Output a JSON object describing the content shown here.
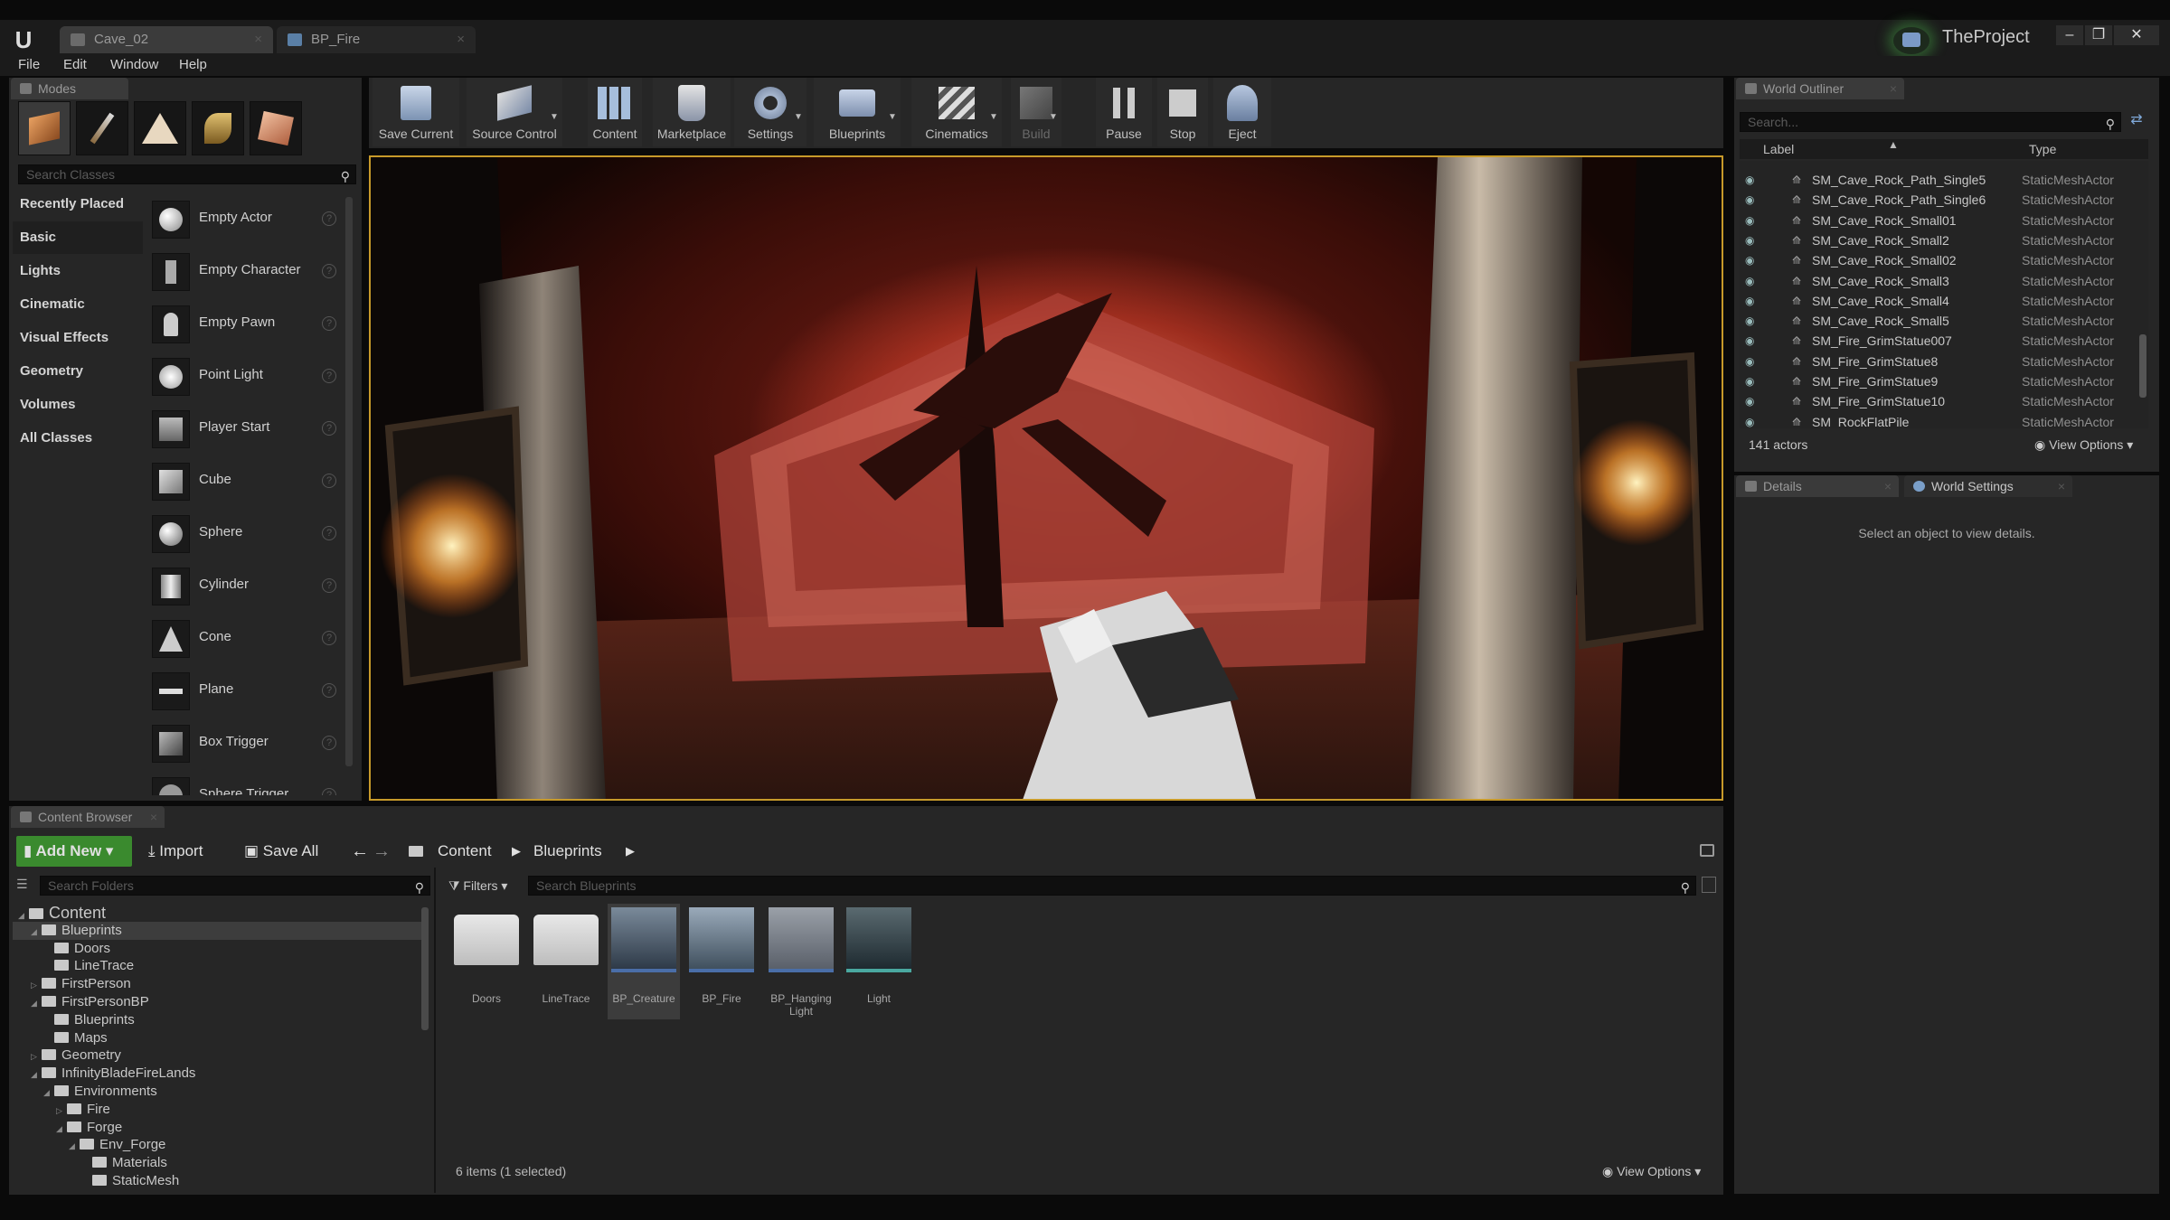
{
  "window": {
    "tabs": [
      {
        "label": "Cave_02"
      },
      {
        "label": "BP_Fire"
      }
    ],
    "project_name": "TheProject",
    "controls": [
      "–",
      "❐",
      "✕"
    ]
  },
  "menu": [
    "File",
    "Edit",
    "Window",
    "Help"
  ],
  "modes_panel": {
    "tab_label": "Modes",
    "search_placeholder": "Search Classes",
    "categories": [
      "Recently Placed",
      "Basic",
      "Lights",
      "Cinematic",
      "Visual Effects",
      "Geometry",
      "Volumes",
      "All Classes"
    ],
    "active_category": "Basic",
    "items": [
      "Empty Actor",
      "Empty Character",
      "Empty Pawn",
      "Point Light",
      "Player Start",
      "Cube",
      "Sphere",
      "Cylinder",
      "Cone",
      "Plane",
      "Box Trigger",
      "Sphere Trigger"
    ]
  },
  "toolbar": {
    "buttons": [
      {
        "label": "Save Current",
        "icon": "save-icon"
      },
      {
        "label": "Source Control",
        "icon": "source-control-icon"
      },
      {
        "label": "Content",
        "icon": "content-icon"
      },
      {
        "label": "Marketplace",
        "icon": "marketplace-icon"
      },
      {
        "label": "Settings",
        "icon": "settings-icon"
      },
      {
        "label": "Blueprints",
        "icon": "blueprints-icon"
      },
      {
        "label": "Cinematics",
        "icon": "cinematics-icon"
      },
      {
        "label": "Build",
        "icon": "build-icon"
      },
      {
        "label": "Pause",
        "icon": "pause-icon"
      },
      {
        "label": "Stop",
        "icon": "stop-icon"
      },
      {
        "label": "Eject",
        "icon": "eject-icon"
      }
    ]
  },
  "world_outliner": {
    "tab_label": "World Outliner",
    "search_placeholder": "Search...",
    "col_label": "Label",
    "col_type": "Type",
    "rows": [
      {
        "label": "SM_Cave_Rock_Path_Single5",
        "type": "StaticMeshActor"
      },
      {
        "label": "SM_Cave_Rock_Path_Single6",
        "type": "StaticMeshActor"
      },
      {
        "label": "SM_Cave_Rock_Small01",
        "type": "StaticMeshActor"
      },
      {
        "label": "SM_Cave_Rock_Small2",
        "type": "StaticMeshActor"
      },
      {
        "label": "SM_Cave_Rock_Small02",
        "type": "StaticMeshActor"
      },
      {
        "label": "SM_Cave_Rock_Small3",
        "type": "StaticMeshActor"
      },
      {
        "label": "SM_Cave_Rock_Small4",
        "type": "StaticMeshActor"
      },
      {
        "label": "SM_Cave_Rock_Small5",
        "type": "StaticMeshActor"
      },
      {
        "label": "SM_Fire_GrimStatue007",
        "type": "StaticMeshActor"
      },
      {
        "label": "SM_Fire_GrimStatue8",
        "type": "StaticMeshActor"
      },
      {
        "label": "SM_Fire_GrimStatue9",
        "type": "StaticMeshActor"
      },
      {
        "label": "SM_Fire_GrimStatue10",
        "type": "StaticMeshActor"
      },
      {
        "label": "SM_RockFlatPile",
        "type": "StaticMeshActor"
      }
    ],
    "actor_count": "141 actors",
    "view_options": "View Options"
  },
  "details": {
    "tab_label": "Details",
    "world_settings_tab": "World Settings",
    "empty_message": "Select an object to view details."
  },
  "content_browser": {
    "tab_label": "Content Browser",
    "add_new": "Add New",
    "import": "Import",
    "save_all": "Save All",
    "path": [
      "Content",
      "Blueprints"
    ],
    "search_folders_placeholder": "Search Folders",
    "filters": "Filters",
    "search_assets_placeholder": "Search Blueprints",
    "tree": [
      {
        "label": "Content",
        "level": 0,
        "expanded": true
      },
      {
        "label": "Blueprints",
        "level": 1,
        "expanded": true,
        "selected": true
      },
      {
        "label": "Doors",
        "level": 2
      },
      {
        "label": "LineTrace",
        "level": 2
      },
      {
        "label": "FirstPerson",
        "level": 1,
        "collapsed": true
      },
      {
        "label": "FirstPersonBP",
        "level": 1,
        "expanded": true
      },
      {
        "label": "Blueprints",
        "level": 2
      },
      {
        "label": "Maps",
        "level": 2
      },
      {
        "label": "Geometry",
        "level": 1,
        "collapsed": true
      },
      {
        "label": "InfinityBladeFireLands",
        "level": 1,
        "expanded": true
      },
      {
        "label": "Environments",
        "level": 2,
        "expanded": true
      },
      {
        "label": "Fire",
        "level": 3,
        "collapsed": true
      },
      {
        "label": "Forge",
        "level": 3,
        "expanded": true
      },
      {
        "label": "Env_Forge",
        "level": 4,
        "expanded": true
      },
      {
        "label": "Materials",
        "level": 5
      },
      {
        "label": "StaticMesh",
        "level": 5
      }
    ],
    "assets": [
      {
        "label": "Doors",
        "kind": "folder"
      },
      {
        "label": "LineTrace",
        "kind": "folder"
      },
      {
        "label": "BP_Creature",
        "kind": "blueprint",
        "selected": true
      },
      {
        "label": "BP_Fire",
        "kind": "blueprint"
      },
      {
        "label": "BP_Hanging Light",
        "kind": "blueprint"
      },
      {
        "label": "Light",
        "kind": "blueprint"
      }
    ],
    "status": "6 items (1 selected)",
    "view_options": "View Options"
  },
  "colors": {
    "viewport_border": "#c79a2a",
    "add_new_green": "#3a8a2e",
    "selection_blue": "#4a6ea8"
  }
}
